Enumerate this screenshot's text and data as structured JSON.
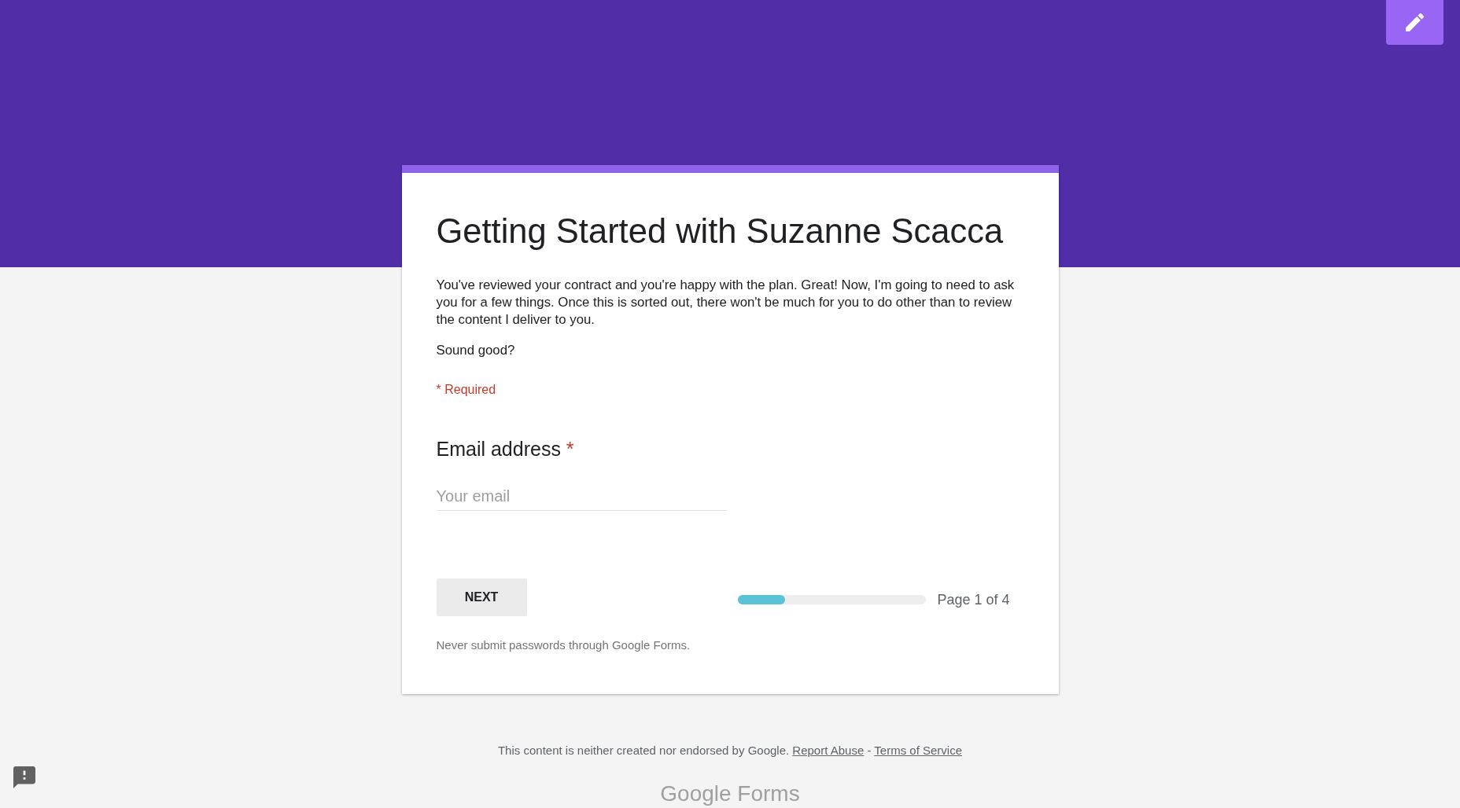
{
  "form": {
    "title": "Getting Started with Suzanne Scacca",
    "description": [
      "You've reviewed your contract and you're happy with the plan. Great! Now, I'm going to need to ask you for a few things. Once this is sorted out, there won't be much for you to do other than to review the content I deliver to you.",
      "Sound good?"
    ],
    "required_note": "* Required",
    "questions": [
      {
        "label": "Email address",
        "required_mark": "*",
        "placeholder": "Your email"
      }
    ],
    "next_button": "NEXT",
    "progress": {
      "level": 0.25,
      "label": "Page 1 of 4"
    },
    "password_warning": "Never submit passwords through Google Forms."
  },
  "footer": {
    "disclaimer": "This content is neither created nor endorsed by Google.",
    "links": [
      "Report Abuse",
      "Terms of Service"
    ],
    "separator": "-",
    "logo": "Google Forms"
  }
}
